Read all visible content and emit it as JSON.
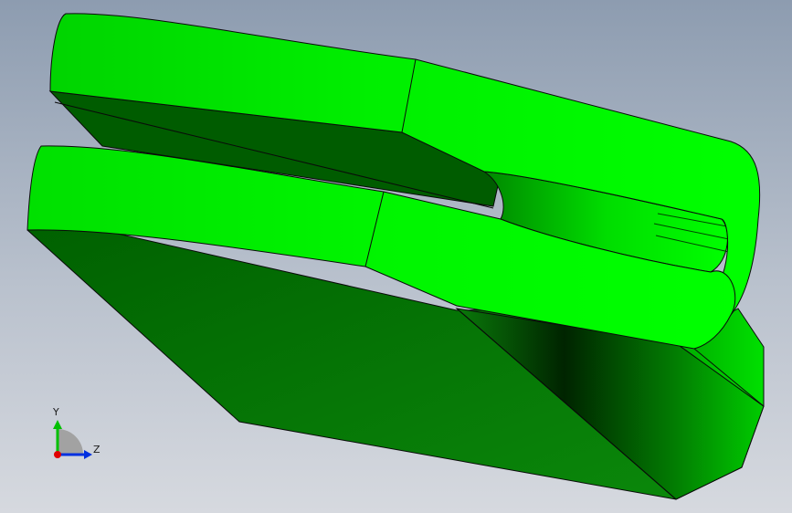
{
  "viewport": {
    "background_top": "#8d9cb0",
    "background_bottom": "#d6d9df"
  },
  "model": {
    "color_face_light": "#00ff00",
    "color_face_mid": "#00dd00",
    "color_face_dark": "#006400",
    "color_edge": "#0a0a0a"
  },
  "triad": {
    "y_label": "Y",
    "z_label": "Z",
    "x_axis_color": "#e00000",
    "y_axis_color": "#00c000",
    "z_axis_color": "#0030e0"
  }
}
